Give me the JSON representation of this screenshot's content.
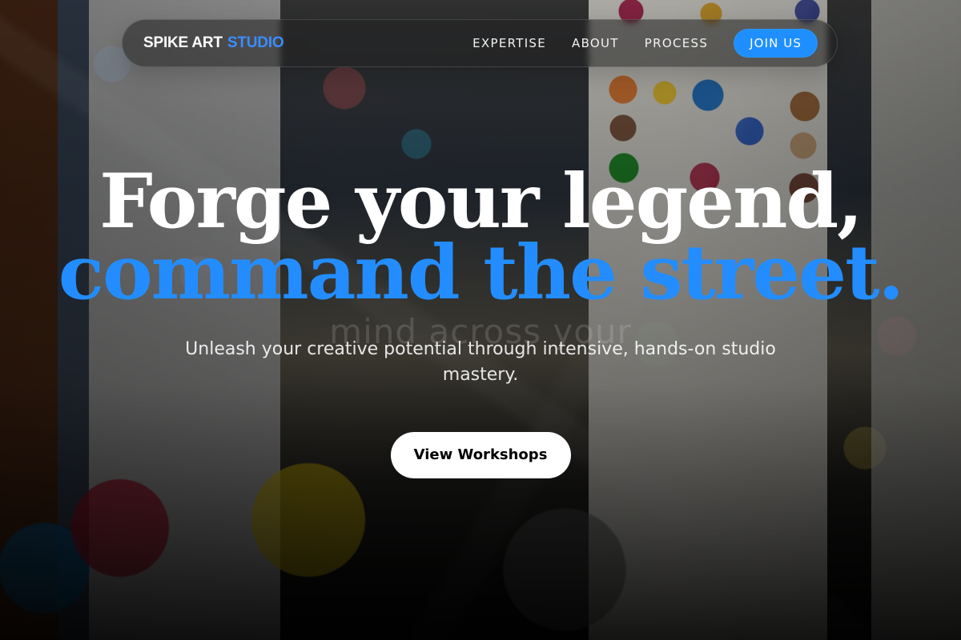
{
  "brand": {
    "logo_primary": "SPIKE ART",
    "logo_accent": "STUDIO"
  },
  "nav": {
    "items": [
      "EXPERTISE",
      "ABOUT",
      "PROCESS"
    ],
    "join_label": "JOIN US"
  },
  "hero": {
    "line1": "Forge your legend,",
    "line2": "command the street.",
    "subtitle": "Unleash your creative potential through intensive, hands-on studio mastery.",
    "button_label": "View Workshops",
    "background_text": "mind across your"
  },
  "colors": {
    "accent": "#238dff",
    "cta_background": "#ffffff",
    "nav_background": "rgba(32,32,32,0.55)"
  }
}
